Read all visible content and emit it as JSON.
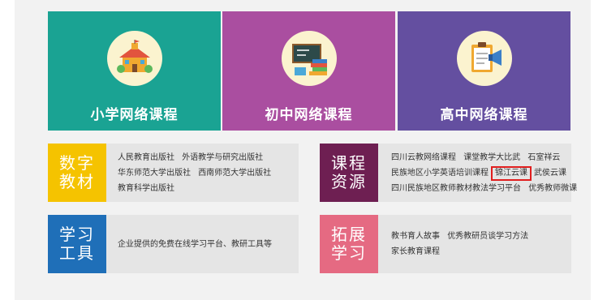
{
  "colors": {
    "primary_card": "#1aa393",
    "middle_card": "#aa4ea0",
    "high_card": "#644fa0",
    "digital_tile": "#f5c300",
    "course_tile": "#6e1f52",
    "tools_tile": "#1f6fb8",
    "extend_tile": "#e56a82",
    "highlight_border": "#e01e1e"
  },
  "courses": [
    {
      "label": "小学网络课程",
      "icon": "school-building-icon"
    },
    {
      "label": "初中网络课程",
      "icon": "chalkboard-books-icon"
    },
    {
      "label": "高中网络课程",
      "icon": "clipboard-megaphone-icon"
    }
  ],
  "digital_materials": {
    "title_line1": "数字",
    "title_line2": "教材",
    "links": [
      [
        "人民教育出版社",
        "外语教学与研究出版社"
      ],
      [
        "华东师范大学出版社",
        "西南师范大学出版社"
      ],
      [
        "教育科学出版社"
      ]
    ]
  },
  "course_resources": {
    "title_line1": "课程",
    "title_line2": "资源",
    "row1": [
      "四川云教网络课程",
      "课堂教学大比武",
      "石室祥云"
    ],
    "row2_before": "民族地区小学英语培训课程",
    "row2_highlight": "锦江云课",
    "row2_after": "武侯云课",
    "row3": [
      "四川民族地区教师教材教法学习平台",
      "优秀教师微课"
    ]
  },
  "study_tools": {
    "title_line1": "学习",
    "title_line2": "工具",
    "text": "企业提供的免费在线学习平台、教研工具等"
  },
  "extended_learning": {
    "title_line1": "拓展",
    "title_line2": "学习",
    "row1": [
      "教书育人故事",
      "优秀教研员谈学习方法"
    ],
    "row2": [
      "家长教育课程"
    ]
  }
}
